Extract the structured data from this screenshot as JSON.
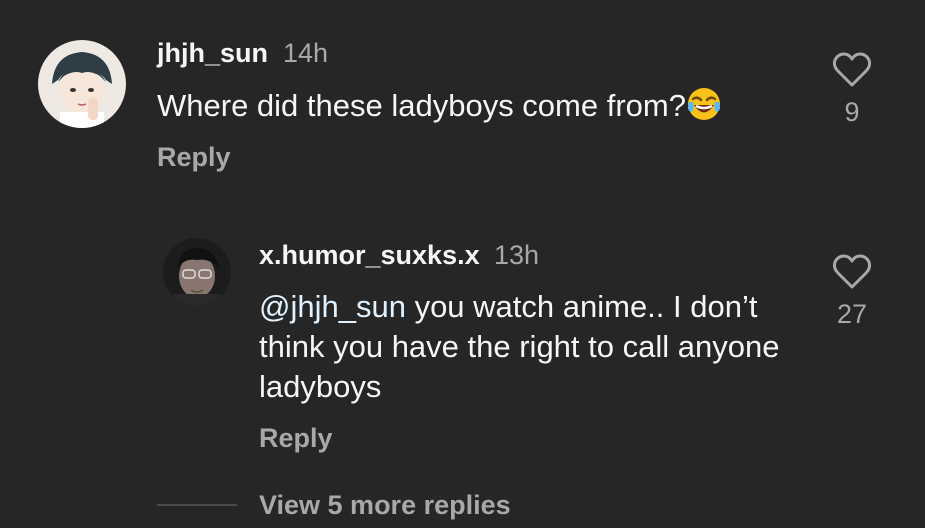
{
  "comments": [
    {
      "username": "jhjh_sun",
      "time": "14h",
      "text": "Where did these ladyboys come from?",
      "emoji": "face-with-tears-of-joy",
      "reply_label": "Reply",
      "like_count": "9",
      "like_icon": "heart-outline-icon"
    },
    {
      "username": "x.humor_suxks.x",
      "time": "13h",
      "mention": "@jhjh_sun",
      "text": " you watch anime.. I don’t think you have the right to call anyone ladyboys",
      "reply_label": "Reply",
      "like_count": "27",
      "like_icon": "heart-outline-icon"
    }
  ],
  "more_replies_label": "View 5 more replies",
  "colors": {
    "background": "#262626",
    "primary_text": "#f5f5f5",
    "secondary_text": "#a8a8a8",
    "mention": "#e0f1ff"
  }
}
